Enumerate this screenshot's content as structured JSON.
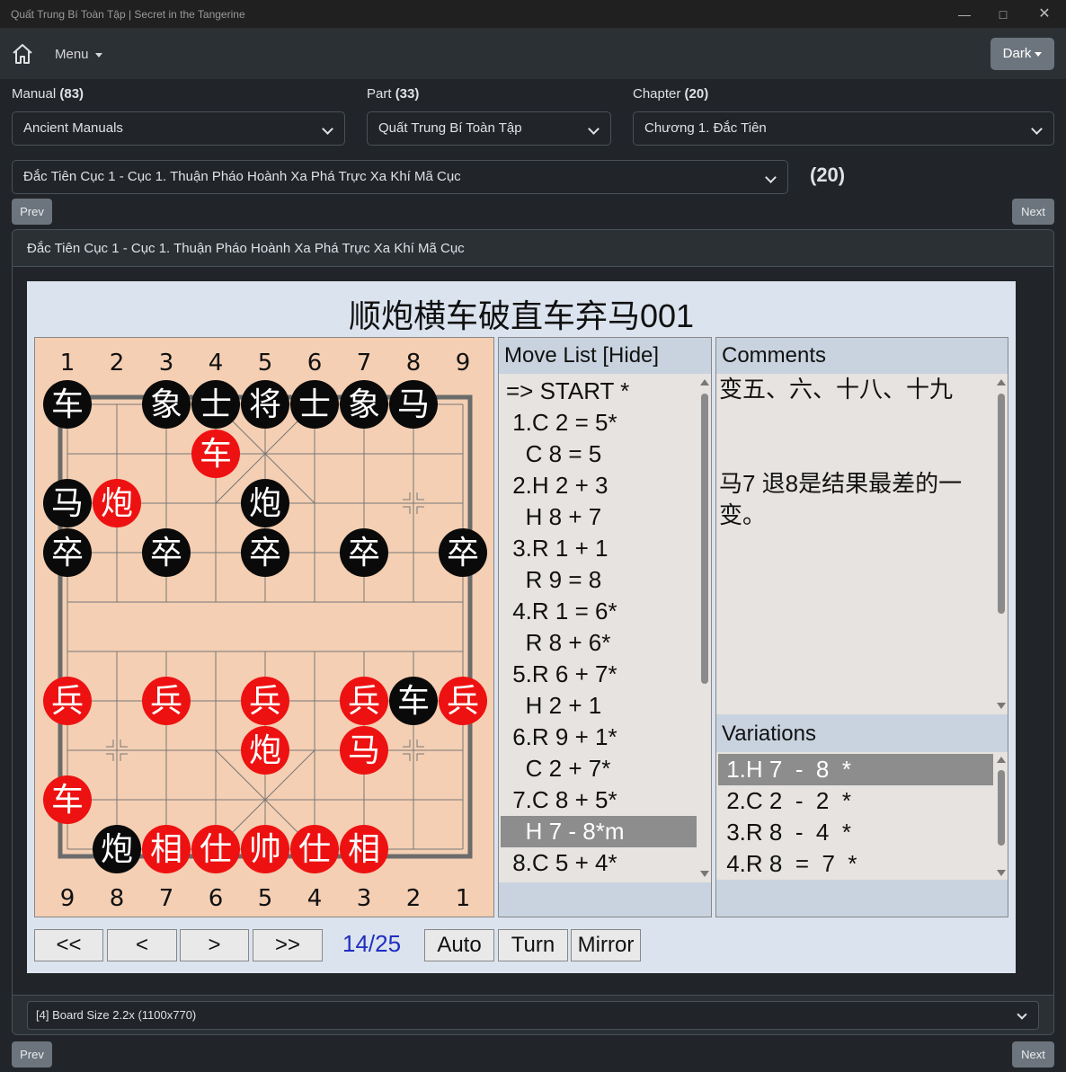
{
  "window": {
    "title": "Quất Trung Bí Toàn Tập | Secret in the Tangerine"
  },
  "nav": {
    "menu_label": "Menu",
    "theme_button": "Dark"
  },
  "filters": {
    "manual": {
      "label": "Manual",
      "count": "(83)",
      "value": "Ancient Manuals"
    },
    "part": {
      "label": "Part",
      "count": "(33)",
      "value": "Quất Trung Bí Toàn Tập"
    },
    "chapter": {
      "label": "Chapter",
      "count": "(20)",
      "value": "Chương 1. Đắc Tiên"
    },
    "game": {
      "value": "Đắc Tiên Cục 1 - Cục 1. Thuận Pháo Hoành Xa Phá Trực Xa Khí Mã Cục",
      "count": "(20)"
    }
  },
  "buttons": {
    "prev": "Prev",
    "next": "Next"
  },
  "card": {
    "header": "Đắc Tiên Cục 1 - Cục 1. Thuận Pháo Hoành Xa Phá Trực Xa Khí Mã Cục"
  },
  "game": {
    "title": "顺炮横车破直车弃马001",
    "top_files": [
      "1",
      "2",
      "3",
      "4",
      "5",
      "6",
      "7",
      "8",
      "9"
    ],
    "bottom_files": [
      "9",
      "8",
      "7",
      "6",
      "5",
      "4",
      "3",
      "2",
      "1"
    ],
    "pieces": [
      {
        "c": "车",
        "side": "black",
        "f": 0,
        "r": 0
      },
      {
        "c": "象",
        "side": "black",
        "f": 2,
        "r": 0
      },
      {
        "c": "士",
        "side": "black",
        "f": 3,
        "r": 0
      },
      {
        "c": "将",
        "side": "black",
        "f": 4,
        "r": 0
      },
      {
        "c": "士",
        "side": "black",
        "f": 5,
        "r": 0
      },
      {
        "c": "象",
        "side": "black",
        "f": 6,
        "r": 0
      },
      {
        "c": "马",
        "side": "black",
        "f": 7,
        "r": 0
      },
      {
        "c": "车",
        "side": "red",
        "f": 3,
        "r": 1
      },
      {
        "c": "马",
        "side": "black",
        "f": 0,
        "r": 2
      },
      {
        "c": "炮",
        "side": "red",
        "f": 1,
        "r": 2
      },
      {
        "c": "炮",
        "side": "black",
        "f": 4,
        "r": 2
      },
      {
        "c": "卒",
        "side": "black",
        "f": 0,
        "r": 3
      },
      {
        "c": "卒",
        "side": "black",
        "f": 2,
        "r": 3
      },
      {
        "c": "卒",
        "side": "black",
        "f": 4,
        "r": 3
      },
      {
        "c": "卒",
        "side": "black",
        "f": 6,
        "r": 3
      },
      {
        "c": "卒",
        "side": "black",
        "f": 8,
        "r": 3
      },
      {
        "c": "兵",
        "side": "red",
        "f": 0,
        "r": 6
      },
      {
        "c": "兵",
        "side": "red",
        "f": 2,
        "r": 6
      },
      {
        "c": "兵",
        "side": "red",
        "f": 4,
        "r": 6
      },
      {
        "c": "兵",
        "side": "red",
        "f": 6,
        "r": 6
      },
      {
        "c": "车",
        "side": "black",
        "f": 7,
        "r": 6
      },
      {
        "c": "兵",
        "side": "red",
        "f": 8,
        "r": 6
      },
      {
        "c": "炮",
        "side": "red",
        "f": 4,
        "r": 7
      },
      {
        "c": "马",
        "side": "red",
        "f": 6,
        "r": 7
      },
      {
        "c": "车",
        "side": "red",
        "f": 0,
        "r": 8
      },
      {
        "c": "炮",
        "side": "black",
        "f": 1,
        "r": 9
      },
      {
        "c": "相",
        "side": "red",
        "f": 2,
        "r": 9
      },
      {
        "c": "仕",
        "side": "red",
        "f": 3,
        "r": 9
      },
      {
        "c": "帅",
        "side": "red",
        "f": 4,
        "r": 9
      },
      {
        "c": "仕",
        "side": "red",
        "f": 5,
        "r": 9
      },
      {
        "c": "相",
        "side": "red",
        "f": 6,
        "r": 9
      }
    ],
    "movelist_header": "Move List [Hide]",
    "moves": [
      "=> START *",
      " 1.C 2 = 5*",
      "   C 8 = 5",
      " 2.H 2 + 3",
      "   H 8 + 7",
      " 3.R 1 + 1",
      "   R 9 = 8",
      " 4.R 1 = 6*",
      "   R 8 + 6*",
      " 5.R 6 + 7*",
      "   H 2 + 1",
      " 6.R 9 + 1*",
      "   C 2 + 7*",
      " 7.C 8 + 5*",
      "   H 7 - 8*m",
      " 8.C 5 + 4*"
    ],
    "selected_move_index": 14,
    "comments_header": "Comments",
    "comment_line1": "变五、六、十八、十九",
    "comment_line2": "马7 退8是结果最差的一",
    "comment_line3": "变。",
    "variations_header": "Variations",
    "variations": [
      " 1.H 7  -  8  *",
      " 2.C 2  -  2  *",
      " 3.R 8  -  4  *",
      " 4.R 8  =  7  *"
    ],
    "selected_variation_index": 0,
    "controls": {
      "first": "<<",
      "prev": "<",
      "next": ">",
      "last": ">>",
      "counter": "14/25",
      "auto": "Auto",
      "turn": "Turn",
      "mirror": "Mirror"
    }
  },
  "board_size": {
    "value": "[4] Board Size 2.2x (1100x770)"
  },
  "colors": {
    "red_piece": "#ee1111",
    "black_piece": "#0a0a0a",
    "board": "#f4cfb3",
    "highlight": "#8d8d8d"
  }
}
